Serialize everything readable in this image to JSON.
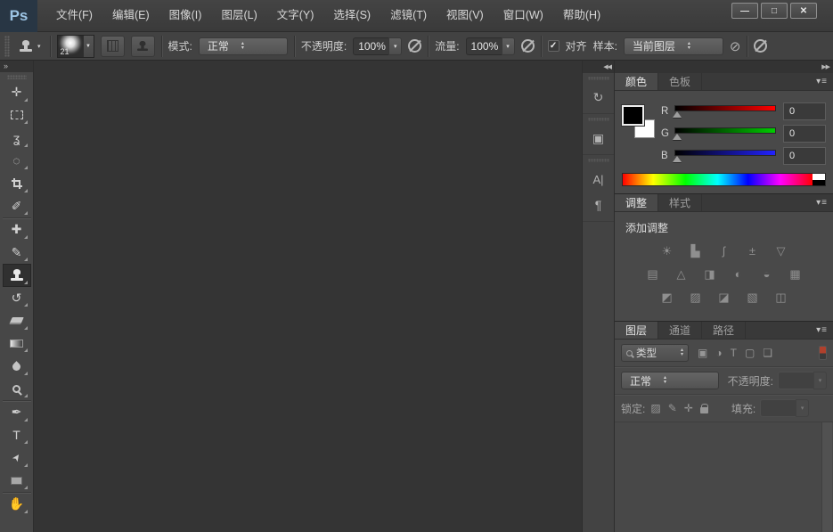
{
  "titlebar": {
    "logo": "Ps",
    "menus": [
      "文件(F)",
      "编辑(E)",
      "图像(I)",
      "图层(L)",
      "文字(Y)",
      "选择(S)",
      "滤镜(T)",
      "视图(V)",
      "窗口(W)",
      "帮助(H)"
    ],
    "window": {
      "minimize": "—",
      "maximize": "□",
      "close": "✕"
    }
  },
  "optionsbar": {
    "brush_size": "21",
    "mode_label": "模式:",
    "mode_value": "正常",
    "opacity_label": "不透明度:",
    "opacity_value": "100%",
    "flow_label": "流量:",
    "flow_value": "100%",
    "align_check": "✓",
    "align_label": "对齐",
    "sample_label": "样本:",
    "sample_value": "当前图层",
    "ignore_adjust_icon": "⊘"
  },
  "toolbar": {
    "collapse": "»",
    "tools": [
      {
        "name": "move",
        "glyph": "✛"
      },
      {
        "name": "rectangular-marquee",
        "glyph": ""
      },
      {
        "name": "lasso",
        "glyph": "ʓ"
      },
      {
        "name": "quick-selection",
        "glyph": "◌"
      },
      {
        "name": "crop",
        "glyph": ""
      },
      {
        "name": "eyedropper",
        "glyph": "✐"
      },
      {
        "name": "spot-healing-brush",
        "glyph": "✚"
      },
      {
        "name": "brush",
        "glyph": "✎"
      },
      {
        "name": "clone-stamp",
        "glyph": "",
        "selected": true
      },
      {
        "name": "history-brush",
        "glyph": "↺"
      },
      {
        "name": "eraser",
        "glyph": ""
      },
      {
        "name": "gradient",
        "glyph": ""
      },
      {
        "name": "blur",
        "glyph": ""
      },
      {
        "name": "dodge",
        "glyph": ""
      },
      {
        "name": "pen",
        "glyph": "✒"
      },
      {
        "name": "type",
        "glyph": "T"
      },
      {
        "name": "path-selection",
        "glyph": "➤"
      },
      {
        "name": "rectangle",
        "glyph": ""
      },
      {
        "name": "hand",
        "glyph": "✋"
      }
    ]
  },
  "dock_strip": {
    "collapse": "◀◀",
    "panels": [
      {
        "name": "history",
        "glyph": "↻"
      },
      {
        "name": "properties",
        "glyph": "▣"
      },
      {
        "name": "character",
        "glyph": "A|"
      },
      {
        "name": "paragraph",
        "glyph": "¶"
      }
    ]
  },
  "panels": {
    "collapse": "▶▶",
    "menu_icon": "▾≡",
    "color": {
      "tabs": [
        "颜色",
        "色板"
      ],
      "active_tab": "颜色",
      "sliders": [
        {
          "label": "R",
          "value": "0"
        },
        {
          "label": "G",
          "value": "0"
        },
        {
          "label": "B",
          "value": "0"
        }
      ]
    },
    "adjustments": {
      "tabs": [
        "调整",
        "样式"
      ],
      "active_tab": "调整",
      "title": "添加调整",
      "rows": [
        [
          {
            "name": "brightness-contrast",
            "glyph": "☀"
          },
          {
            "name": "levels",
            "glyph": "▙"
          },
          {
            "name": "curves",
            "glyph": "ʃ"
          },
          {
            "name": "exposure",
            "glyph": "±"
          },
          {
            "name": "vibrance",
            "glyph": "▽"
          }
        ],
        [
          {
            "name": "hue-saturation",
            "glyph": "▤"
          },
          {
            "name": "color-balance",
            "glyph": "△"
          },
          {
            "name": "black-white",
            "glyph": "◨"
          },
          {
            "name": "photo-filter",
            "glyph": "◐"
          },
          {
            "name": "channel-mixer",
            "glyph": "◒"
          },
          {
            "name": "color-lookup",
            "glyph": "▦"
          }
        ],
        [
          {
            "name": "invert",
            "glyph": "◩"
          },
          {
            "name": "posterize",
            "glyph": "▨"
          },
          {
            "name": "threshold",
            "glyph": "◪"
          },
          {
            "name": "gradient-map",
            "glyph": "▧"
          },
          {
            "name": "selective-color",
            "glyph": "◫"
          }
        ]
      ]
    },
    "layers": {
      "tabs": [
        "图层",
        "通道",
        "路径"
      ],
      "active_tab": "图层",
      "filter_label": "类型",
      "filter_icons": [
        {
          "name": "filter-image",
          "glyph": "▣"
        },
        {
          "name": "filter-adjustment",
          "glyph": "◑"
        },
        {
          "name": "filter-type",
          "glyph": "T"
        },
        {
          "name": "filter-shape",
          "glyph": "▢"
        },
        {
          "name": "filter-smart-object",
          "glyph": "❏"
        }
      ],
      "blend_value": "正常",
      "opacity_label": "不透明度:",
      "lock_label": "锁定:",
      "lock_icons": [
        {
          "name": "lock-transparent-pixels",
          "glyph": "▨"
        },
        {
          "name": "lock-image-pixels",
          "glyph": "✎"
        },
        {
          "name": "lock-position",
          "glyph": "✛"
        }
      ],
      "fill_label": "填充:"
    }
  },
  "colors": {
    "logo_bg": "#283644",
    "logo_text": "#9cc4e4",
    "canvas": "#343434",
    "panel_bg": "#494949",
    "chrome_bg": "#424242",
    "toggle_red": "#b0402c",
    "foreground_swatch": "#000000",
    "background_swatch": "#ffffff"
  }
}
